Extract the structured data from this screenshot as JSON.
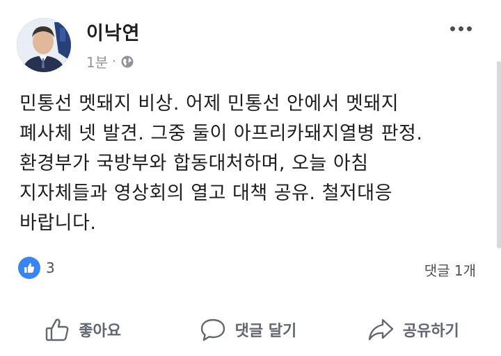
{
  "post": {
    "author": "이낙연",
    "time": "1분",
    "separator": "·",
    "privacy_icon": "globe-icon",
    "more_icon": "more-dots-icon",
    "text_lines": [
      "민통선 멧돼지 비상. 어제 민통선 안에서 멧돼지",
      "폐사체 넷 발견. 그중 둘이 아프리카돼지열병 판정.",
      "환경부가 국방부와 합동대처하며, 오늘 아침",
      "지자체들과 영상회의 열고 대책 공유. 철저대응",
      "바랍니다."
    ]
  },
  "reactions": {
    "icon": "like-icon",
    "count": "3",
    "comments": "댓글 1개"
  },
  "actions": {
    "like_label": "좋아요",
    "comment_label": "댓글 달기",
    "share_label": "공유하기"
  },
  "colors": {
    "like_blue": "#3a86f0",
    "text": "#1c1e21",
    "muted": "#90949c",
    "action": "#606770"
  }
}
